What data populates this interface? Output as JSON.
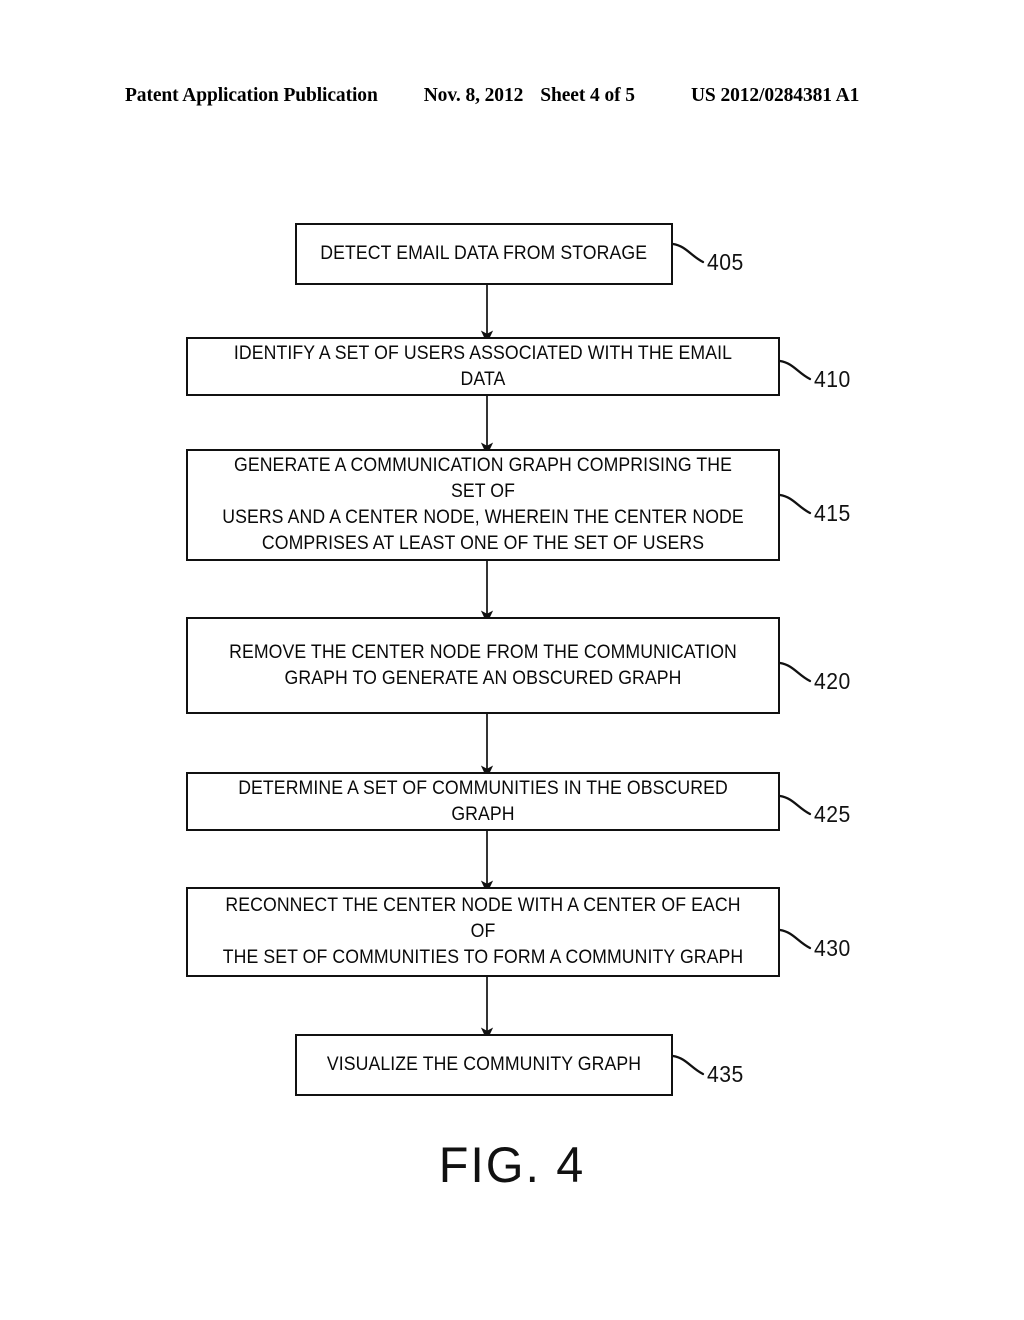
{
  "header": {
    "publication": "Patent Application Publication",
    "date": "Nov. 8, 2012",
    "sheet": "Sheet 4 of 5",
    "patent_number": "US 2012/0284381 A1"
  },
  "figure": {
    "caption": "FIG. 4",
    "type": "flowchart"
  },
  "flowchart": {
    "steps": [
      {
        "ref": "405",
        "text": "DETECT EMAIL DATA FROM STORAGE",
        "lines": 1
      },
      {
        "ref": "410",
        "text": "IDENTIFY A SET OF USERS ASSOCIATED WITH THE EMAIL DATA",
        "lines": 1
      },
      {
        "ref": "415",
        "text": "GENERATE A COMMUNICATION GRAPH COMPRISING THE SET OF\nUSERS AND A CENTER NODE, WHEREIN THE CENTER NODE\nCOMPRISES AT LEAST ONE OF THE SET OF USERS",
        "lines": 3
      },
      {
        "ref": "420",
        "text": "REMOVE THE CENTER NODE FROM THE COMMUNICATION\nGRAPH TO GENERATE AN OBSCURED GRAPH",
        "lines": 2
      },
      {
        "ref": "425",
        "text": "DETERMINE A SET OF COMMUNITIES IN THE OBSCURED GRAPH",
        "lines": 1
      },
      {
        "ref": "430",
        "text": "RECONNECT THE CENTER NODE WITH A CENTER OF EACH OF\nTHE SET OF COMMUNITIES TO FORM A COMMUNITY GRAPH",
        "lines": 2
      },
      {
        "ref": "435",
        "text": "VISUALIZE THE COMMUNITY GRAPH",
        "lines": 1
      }
    ],
    "connector_count": 6,
    "connector_style": "downward-arrow"
  },
  "colors": {
    "page_background": "#ffffff",
    "ink": "#111111",
    "box_border": "#111111",
    "box_fill": "#ffffff"
  }
}
